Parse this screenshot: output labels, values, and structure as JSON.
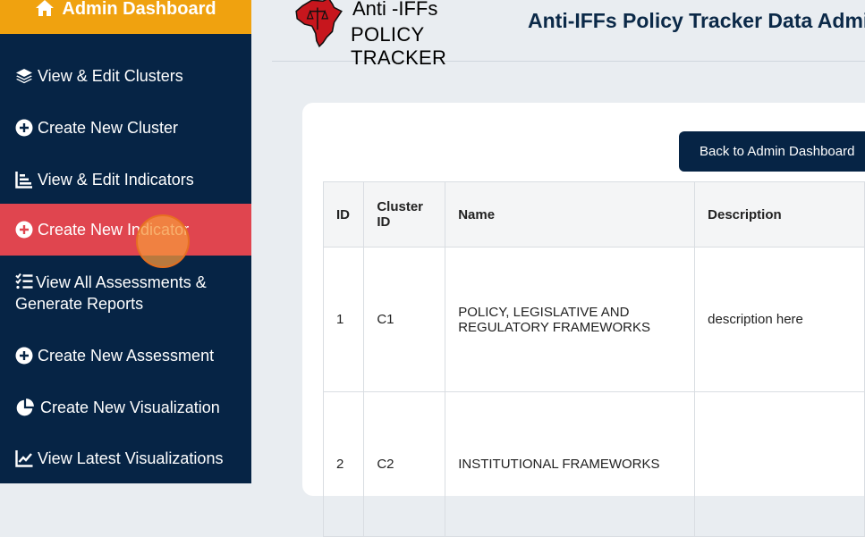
{
  "sidebar": {
    "header": "Admin Dashboard",
    "items": [
      {
        "label": "View & Edit Clusters",
        "icon": "layers-icon"
      },
      {
        "label": "Create New Cluster",
        "icon": "plus-circle-icon"
      },
      {
        "label": "View & Edit Indicators",
        "icon": "chart-list-icon"
      },
      {
        "label": "Create New Indicator",
        "icon": "plus-circle-icon",
        "active": true
      },
      {
        "label": "View All Assessments & Generate Reports",
        "icon": "checklist-icon"
      },
      {
        "label": "Create New Assessment",
        "icon": "plus-circle-icon"
      },
      {
        "label": "Create New Visualization",
        "icon": "pie-chart-icon"
      },
      {
        "label": "View Latest Visualizations",
        "icon": "line-chart-icon"
      }
    ]
  },
  "header": {
    "logo_line1": "Anti -IFFs",
    "logo_line2": "POLICY TRACKER",
    "title": "Anti-IFFs Policy Tracker Data Admin"
  },
  "main": {
    "back_button": "Back to Admin Dashboard",
    "table": {
      "columns": [
        "ID",
        "Cluster ID",
        "Name",
        "Description"
      ],
      "rows": [
        {
          "id": "1",
          "cluster_id": "C1",
          "name": "POLICY, LEGISLATIVE AND REGULATORY FRAMEWORKS",
          "description": "description here"
        },
        {
          "id": "2",
          "cluster_id": "C2",
          "name": "INSTITUTIONAL FRAMEWORKS",
          "description": ""
        }
      ]
    }
  },
  "colors": {
    "sidebar_bg": "#062445",
    "sidebar_header": "#f0a20f",
    "active_item": "#e0454f",
    "button_bg": "#062445",
    "title": "#0b2948"
  }
}
